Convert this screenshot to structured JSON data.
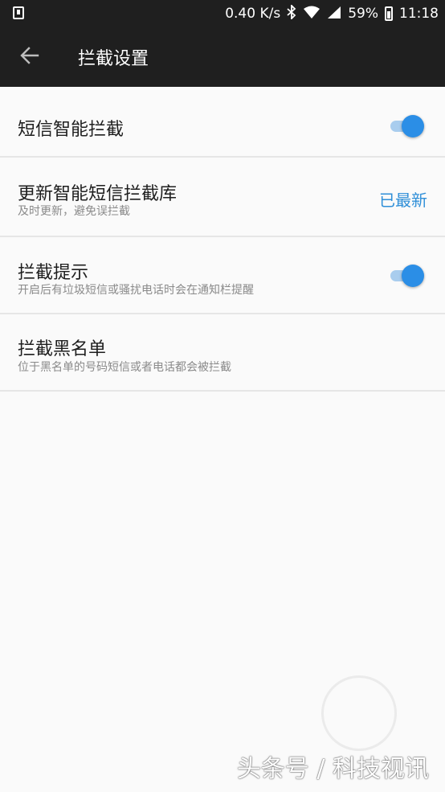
{
  "status_bar": {
    "speed": "0.40 K/s",
    "battery": "59%",
    "time": "11:18",
    "icons": [
      "notification-icon",
      "bluetooth-icon",
      "wifi-icon",
      "signal-icon",
      "battery-icon"
    ]
  },
  "app_bar": {
    "title": "拦截设置",
    "back_icon": "arrow-left-icon"
  },
  "settings": {
    "sms_smart_block": {
      "title": "短信智能拦截",
      "enabled": true
    },
    "update_library": {
      "title": "更新智能短信拦截库",
      "subtitle": "及时更新，避免误拦截",
      "value": "已最新"
    },
    "block_notice": {
      "title": "拦截提示",
      "subtitle": "开启后有垃圾短信或骚扰电话时会在通知栏提醒",
      "enabled": true
    },
    "blacklist": {
      "title": "拦截黑名单",
      "subtitle": "位于黑名单的号码短信或者电话都会被拦截"
    }
  },
  "watermark": {
    "text": "头条号 / 科技视讯"
  },
  "colors": {
    "accent": "#2b8ee6",
    "bar": "#1f1f1f",
    "value_text": "#2f8fd8"
  }
}
